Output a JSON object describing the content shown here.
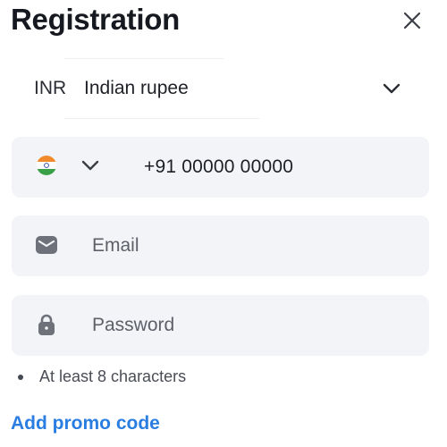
{
  "header": {
    "title": "Registration",
    "close_icon": "close-icon"
  },
  "currency": {
    "code": "INR",
    "name": "Indian rupee",
    "chevron_icon": "chevron-down-icon"
  },
  "phone": {
    "flag_icon": "india-flag-icon",
    "chevron_icon": "chevron-down-icon",
    "value": "+91 00000 00000"
  },
  "email": {
    "icon": "envelope-icon",
    "placeholder": "Email"
  },
  "password": {
    "icon": "lock-icon",
    "placeholder": "Password"
  },
  "requirements": [
    {
      "text": "At least 8 characters"
    }
  ],
  "promo": {
    "label": "Add promo code"
  },
  "colors": {
    "accent": "#2a7de1",
    "field_bg": "#f3f4f7",
    "text": "#16191f",
    "muted": "#5d6068"
  }
}
